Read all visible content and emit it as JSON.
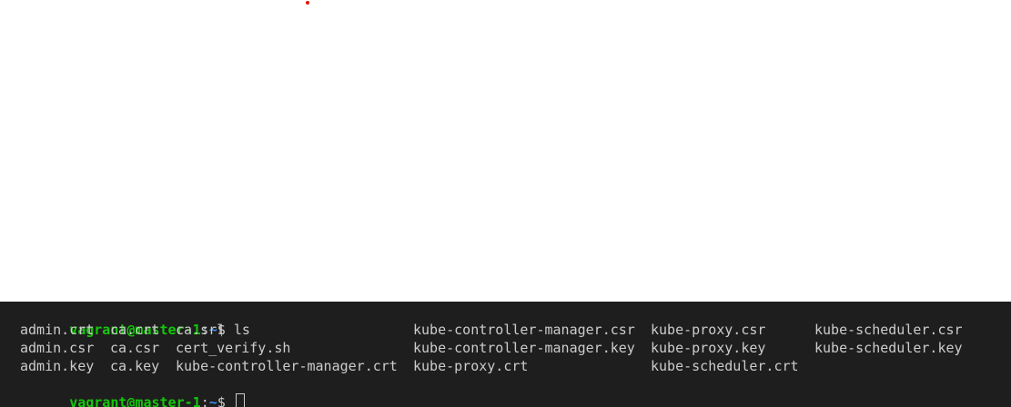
{
  "colors": {
    "terminal_bg": "#1e1e1e",
    "text": "#cccccc",
    "prompt_user": "#16c60c",
    "prompt_path": "#3b8eea",
    "red_dot": "#e51400"
  },
  "prompt": {
    "user": "vagrant@master-1",
    "sep": ":",
    "path": "~",
    "symbol": "$ "
  },
  "command": "ls",
  "ls_output": [
    [
      "admin.crt",
      "ca.crt",
      "ca.srl",
      "kube-controller-manager.csr",
      "kube-proxy.csr",
      "kube-scheduler.csr"
    ],
    [
      "admin.csr",
      "ca.csr",
      "cert_verify.sh",
      "kube-controller-manager.key",
      "kube-proxy.key",
      "kube-scheduler.key"
    ],
    [
      "admin.key",
      "ca.key",
      "kube-controller-manager.crt",
      "kube-proxy.crt",
      "kube-scheduler.crt",
      ""
    ]
  ]
}
